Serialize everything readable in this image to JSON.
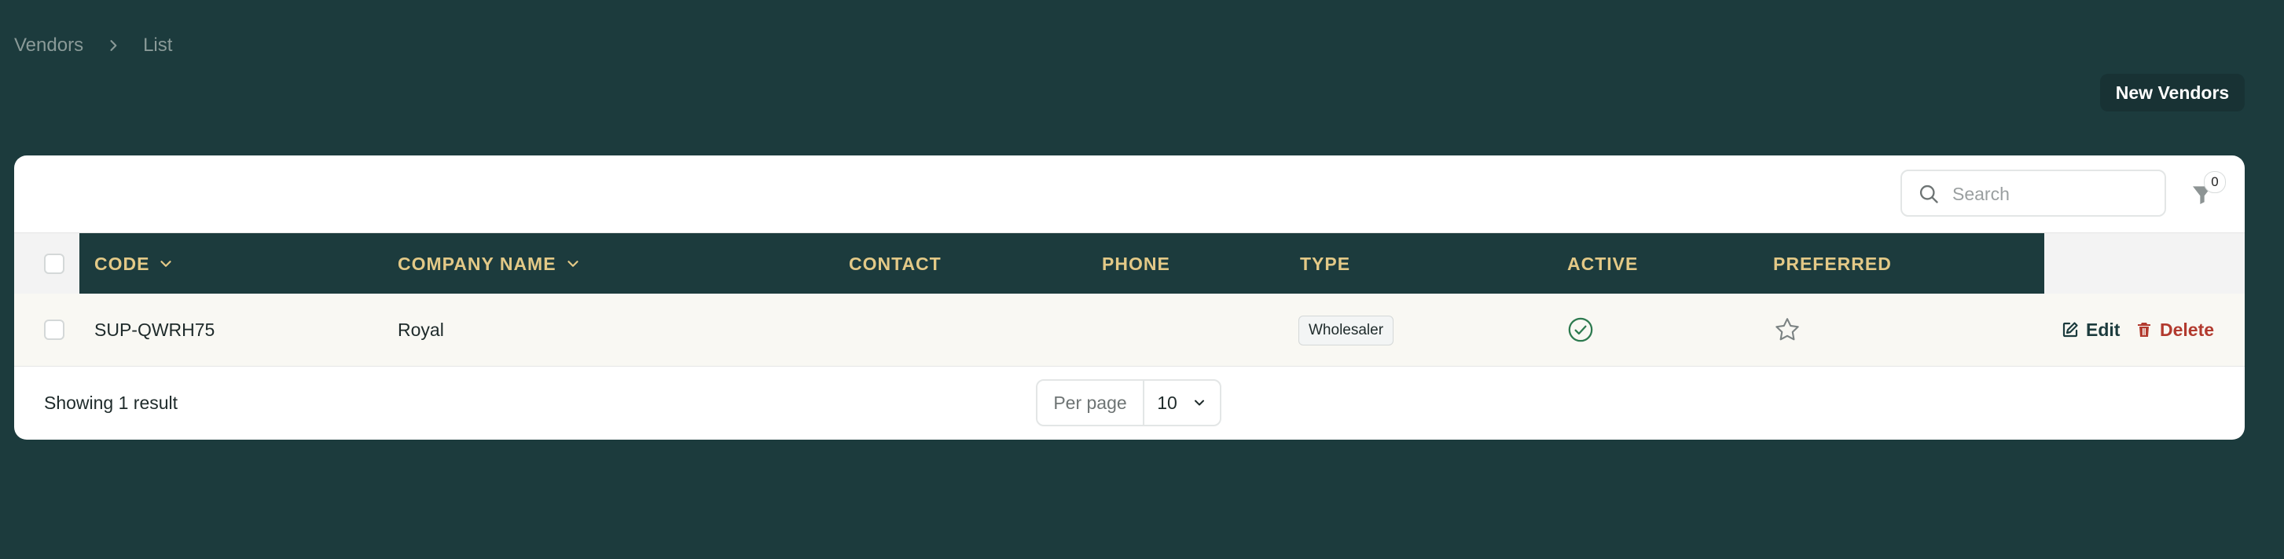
{
  "breadcrumb": {
    "items": [
      "Vendors",
      "List"
    ]
  },
  "header": {
    "new_button": "New Vendors"
  },
  "toolbar": {
    "search_placeholder": "Search",
    "filter_count": "0"
  },
  "table": {
    "columns": [
      "CODE",
      "COMPANY NAME",
      "CONTACT",
      "PHONE",
      "TYPE",
      "ACTIVE",
      "PREFERRED"
    ],
    "rows": [
      {
        "code": "SUP-QWRH75",
        "company_name": "Royal",
        "contact": "",
        "phone": "",
        "type": "Wholesaler",
        "active": true,
        "preferred": false,
        "actions": {
          "edit": "Edit",
          "delete": "Delete"
        }
      }
    ]
  },
  "footer": {
    "showing": "Showing 1 result",
    "per_page_label": "Per page",
    "per_page_value": "10"
  },
  "colors": {
    "background": "#1c3b3d",
    "header_text": "#e3c987",
    "active_check": "#2d7a4f",
    "delete": "#b23a2e"
  },
  "icons": [
    "chevron-right-icon",
    "search-icon",
    "filter-icon",
    "chevron-down-icon",
    "check-circle-icon",
    "star-icon",
    "edit-icon",
    "trash-icon"
  ]
}
